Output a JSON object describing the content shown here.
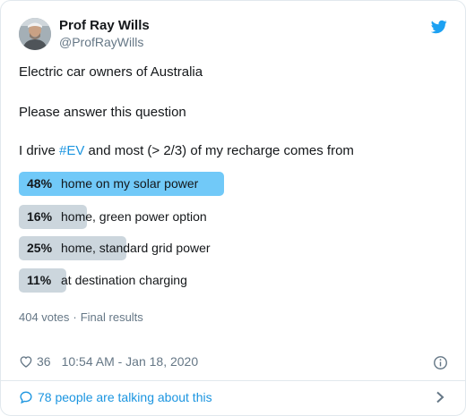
{
  "author": {
    "name": "Prof Ray Wills",
    "handle": "@ProfRayWills"
  },
  "tweet": {
    "line1": "Electric car owners of Australia",
    "line2": "Please answer this question",
    "line3_prefix": "I drive ",
    "line3_hashtag": "#EV",
    "line3_suffix": " and most (> 2/3) of my recharge comes from"
  },
  "poll": {
    "options": [
      {
        "percent": "48%",
        "label": "home on my solar power",
        "share": 0.48,
        "winner": true
      },
      {
        "percent": "16%",
        "label": "home, green power option",
        "share": 0.16,
        "winner": false
      },
      {
        "percent": "25%",
        "label": "home, standard grid power",
        "share": 0.25,
        "winner": false
      },
      {
        "percent": "11%",
        "label": "at destination charging",
        "share": 0.11,
        "winner": false
      }
    ],
    "votes": "404 votes",
    "separator": "·",
    "status": "Final results"
  },
  "footer": {
    "likes": "36",
    "timestamp": "10:54 AM - Jan 18, 2020",
    "talking": "78 people are talking about this"
  },
  "icons": {
    "logo": "twitter-bird-icon",
    "like": "heart-icon",
    "info": "info-icon",
    "reply": "speech-bubble-icon",
    "more": "chevron-right-icon"
  },
  "colors": {
    "accent": "#1b95e0",
    "winner_bar": "#71c9f8",
    "other_bar": "#ccd6dd",
    "muted_text": "#657786"
  }
}
